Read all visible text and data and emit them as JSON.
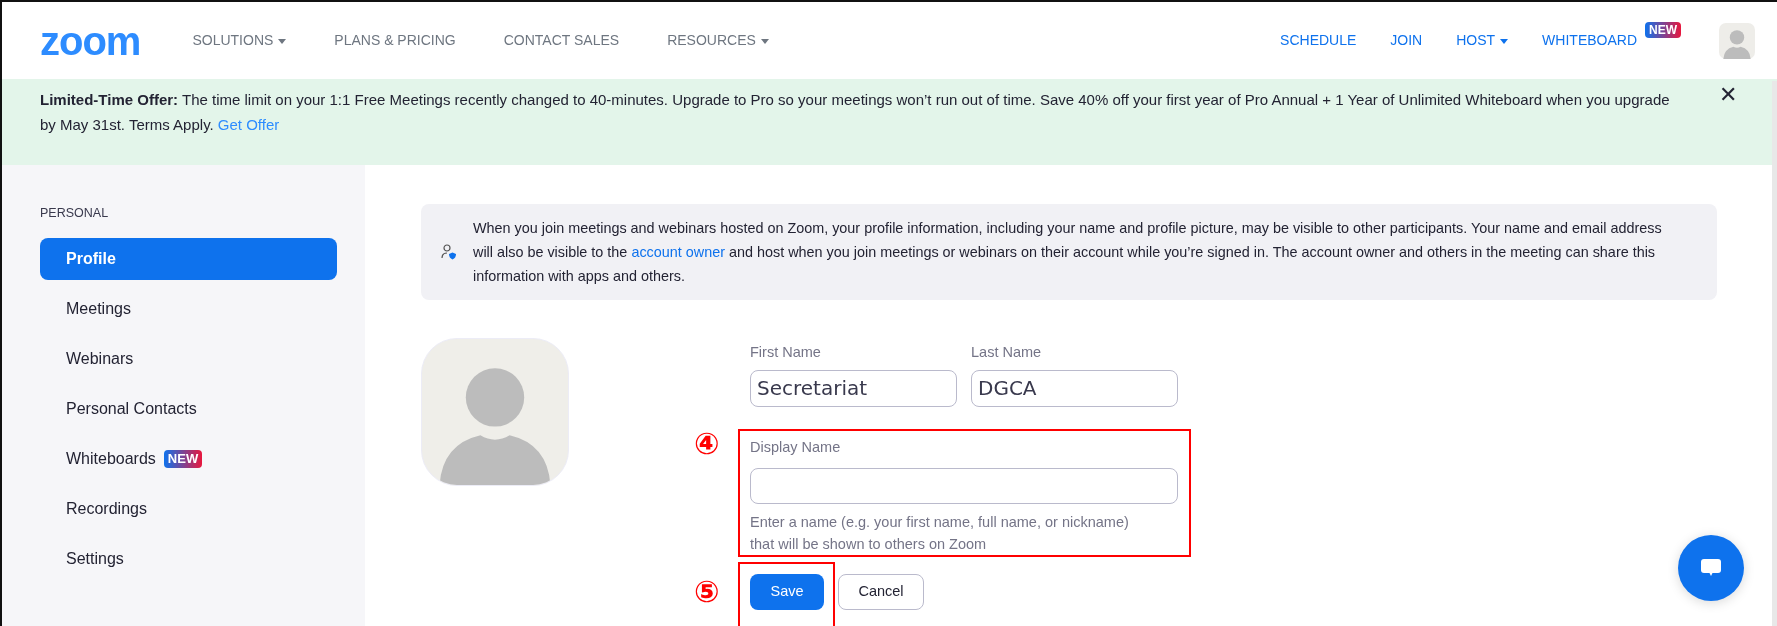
{
  "header": {
    "logo": "zoom",
    "nav_left": [
      {
        "label": "SOLUTIONS",
        "caret": true
      },
      {
        "label": "PLANS & PRICING",
        "caret": false
      },
      {
        "label": "CONTACT SALES",
        "caret": false
      },
      {
        "label": "RESOURCES",
        "caret": true
      }
    ],
    "nav_right": [
      {
        "label": "SCHEDULE",
        "caret": false
      },
      {
        "label": "JOIN",
        "caret": false
      },
      {
        "label": "HOST",
        "caret": true
      },
      {
        "label": "WHITEBOARD",
        "caret": false,
        "badge": "NEW"
      }
    ]
  },
  "banner": {
    "lead": "Limited-Time Offer:",
    "text": "The time limit on your 1:1 Free Meetings recently changed to 40-minutes. Upgrade to Pro so your meetings won’t run out of time. Save 40% off your first year of Pro Annual + 1 Year of Unlimited Whiteboard when you upgrade by May 31st. Terms Apply.",
    "link": "Get Offer",
    "close": "✕"
  },
  "sidebar": {
    "section": "PERSONAL",
    "items": [
      {
        "label": "Profile",
        "selected": true
      },
      {
        "label": "Meetings",
        "selected": false
      },
      {
        "label": "Webinars",
        "selected": false
      },
      {
        "label": "Personal Contacts",
        "selected": false
      },
      {
        "label": "Whiteboards",
        "selected": false,
        "badge": "NEW"
      },
      {
        "label": "Recordings",
        "selected": false
      },
      {
        "label": "Settings",
        "selected": false
      }
    ]
  },
  "notice": {
    "before": "When you join meetings and webinars hosted on Zoom, your profile information, including your name and profile picture, may be visible to other participants. Your name and email address will also be visible to the",
    "link": "account owner",
    "after": "and host when you join meetings or webinars on their account while you’re signed in. The account owner and others in the meeting can share this information with apps and others."
  },
  "form": {
    "first_name": {
      "label": "First Name",
      "value": "Secretariat"
    },
    "last_name": {
      "label": "Last Name",
      "value": "DGCA"
    },
    "display_name": {
      "label": "Display Name",
      "help": "Enter a name (e.g. your first name, full name, or nickname) that will be shown to others on Zoom",
      "annotation": "④"
    },
    "save": {
      "label": "Save",
      "annotation": "⑤"
    },
    "cancel": "Cancel"
  }
}
